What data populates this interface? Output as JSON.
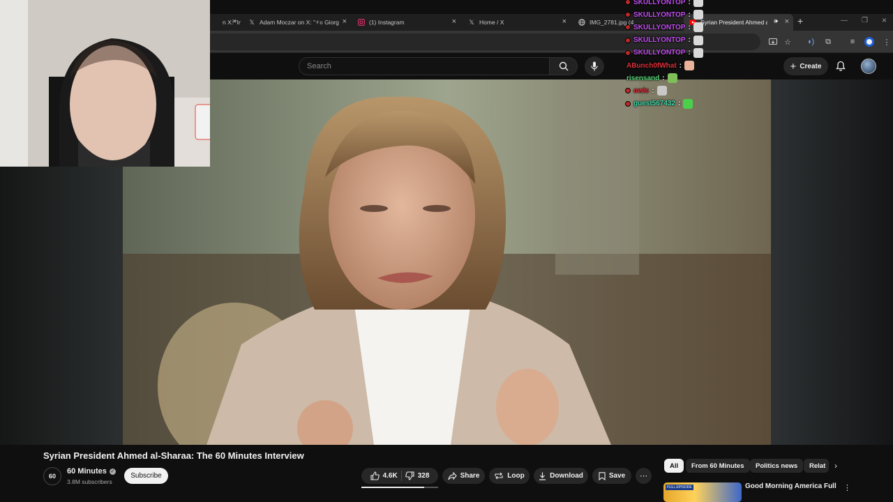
{
  "browser": {
    "tabs": [
      {
        "label": "n X: \"In",
        "icon": "x-logo-icon",
        "active": false
      },
      {
        "label": "Adam Moczar on X: \"⚡ıı Giorg",
        "icon": "x-logo-icon",
        "active": false
      },
      {
        "label": "(1) Instagram",
        "icon": "instagram-icon",
        "active": false
      },
      {
        "label": "Home / X",
        "icon": "x-logo-icon",
        "active": false
      },
      {
        "label": "IMG_2781.jpg (4",
        "icon": "globe-icon",
        "active": false
      },
      {
        "label": "Syrian President Ahmed al-S",
        "icon": "youtube-icon",
        "active": true
      }
    ],
    "new_tab": "+"
  },
  "youtube": {
    "search_placeholder": "Search",
    "create_label": "Create"
  },
  "chat": [
    {
      "user": "SKULLYONTOP",
      "color": "#c24df0",
      "badge": true
    },
    {
      "user": "SKULLYONTOP",
      "color": "#c24df0",
      "badge": true
    },
    {
      "user": "SKULLYONTOP",
      "color": "#c24df0",
      "badge": true
    },
    {
      "user": "SKULLYONTOP",
      "color": "#c24df0",
      "badge": true
    },
    {
      "user": "SKULLYONTOP",
      "color": "#c24df0",
      "badge": true
    },
    {
      "user": "ABunch0fWhat",
      "color": "#e0303a",
      "badge": false
    },
    {
      "user": "risensand",
      "color": "#5ad47b",
      "badge": false
    },
    {
      "user": "owlc",
      "color": "#e0303a",
      "badge": true
    },
    {
      "user": "guest567432",
      "color": "#3fd7a8",
      "badge": true
    }
  ],
  "chat_separator": ":",
  "video": {
    "title": "Syrian President Ahmed al-Sharaa: The 60 Minutes Interview",
    "channel_avatar_text": "60",
    "channel_name": "60 Minutes",
    "subscribers": "3.8M subscribers",
    "subscribe_label": "Subscribe",
    "likes": "4.6K",
    "like_ratio": 0.82,
    "dislikes": "328",
    "share_label": "Share",
    "loop_label": "Loop",
    "download_label": "Download",
    "save_label": "Save"
  },
  "chips": [
    {
      "label": "All",
      "active": true
    },
    {
      "label": "From 60 Minutes",
      "active": false
    },
    {
      "label": "Politics news",
      "active": false
    },
    {
      "label": "Relat",
      "active": false
    }
  ],
  "recommended": {
    "title": "Good Morning America Full",
    "thumb_tag": "FULL EPISODE"
  },
  "colors": {
    "background": "#0f0f0f",
    "chip_active": "#f1f1f1",
    "accent_red": "#ff0000"
  }
}
